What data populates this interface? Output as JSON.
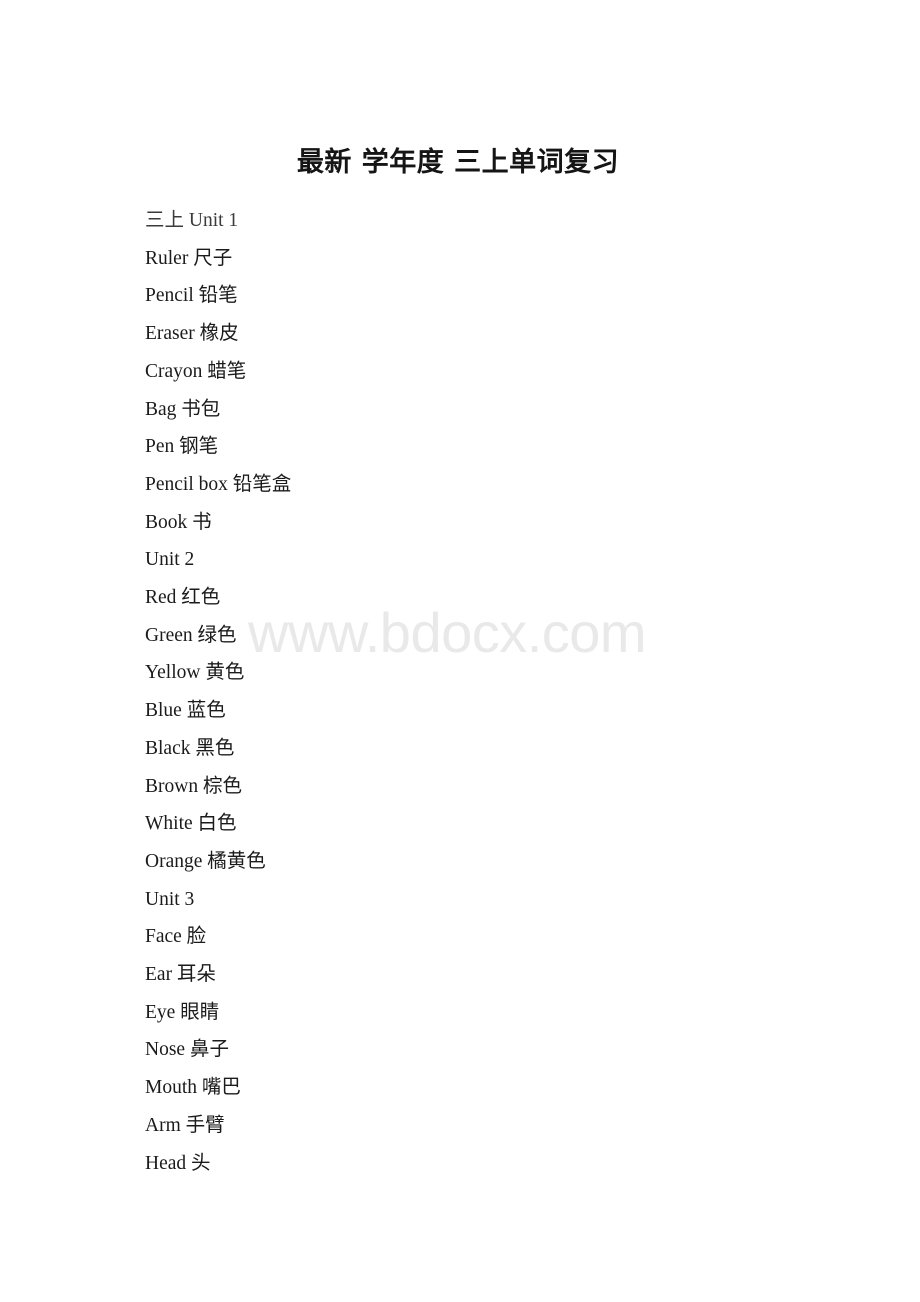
{
  "document": {
    "title": "最新 学年度 三上单词复习",
    "watermark": "www.bdocx.com",
    "background_color": "#ffffff",
    "text_color": "#1b1b1b",
    "watermark_color": "#e9e9e9"
  },
  "lines": [
    {
      "id": "l0",
      "text": "三上 Unit 1",
      "kind": "unit-heading"
    },
    {
      "id": "l1",
      "text": "Ruler 尺子",
      "kind": "vocab"
    },
    {
      "id": "l2",
      "text": "Pencil 铅笔",
      "kind": "vocab"
    },
    {
      "id": "l3",
      "text": "Eraser 橡皮",
      "kind": "vocab"
    },
    {
      "id": "l4",
      "text": "Crayon 蜡笔",
      "kind": "vocab"
    },
    {
      "id": "l5",
      "text": "Bag 书包",
      "kind": "vocab"
    },
    {
      "id": "l6",
      "text": "Pen 钢笔",
      "kind": "vocab"
    },
    {
      "id": "l7",
      "text": "Pencil box 铅笔盒",
      "kind": "vocab"
    },
    {
      "id": "l8",
      "text": "Book 书",
      "kind": "vocab"
    },
    {
      "id": "l9",
      "text": "Unit 2",
      "kind": "unit-heading"
    },
    {
      "id": "l10",
      "text": "Red 红色",
      "kind": "vocab"
    },
    {
      "id": "l11",
      "text": "Green 绿色",
      "kind": "vocab"
    },
    {
      "id": "l12",
      "text": "Yellow 黄色",
      "kind": "vocab"
    },
    {
      "id": "l13",
      "text": "Blue 蓝色",
      "kind": "vocab"
    },
    {
      "id": "l14",
      "text": "Black 黑色",
      "kind": "vocab"
    },
    {
      "id": "l15",
      "text": "Brown 棕色",
      "kind": "vocab"
    },
    {
      "id": "l16",
      "text": "White 白色",
      "kind": "vocab"
    },
    {
      "id": "l17",
      "text": "Orange 橘黄色",
      "kind": "vocab"
    },
    {
      "id": "l18",
      "text": "Unit 3",
      "kind": "unit-heading"
    },
    {
      "id": "l19",
      "text": "Face 脸",
      "kind": "vocab"
    },
    {
      "id": "l20",
      "text": "Ear 耳朵",
      "kind": "vocab"
    },
    {
      "id": "l21",
      "text": "Eye 眼睛",
      "kind": "vocab"
    },
    {
      "id": "l22",
      "text": "Nose 鼻子",
      "kind": "vocab"
    },
    {
      "id": "l23",
      "text": "Mouth 嘴巴",
      "kind": "vocab"
    },
    {
      "id": "l24",
      "text": "Arm 手臂",
      "kind": "vocab"
    },
    {
      "id": "l25",
      "text": "Head 头",
      "kind": "vocab"
    }
  ]
}
